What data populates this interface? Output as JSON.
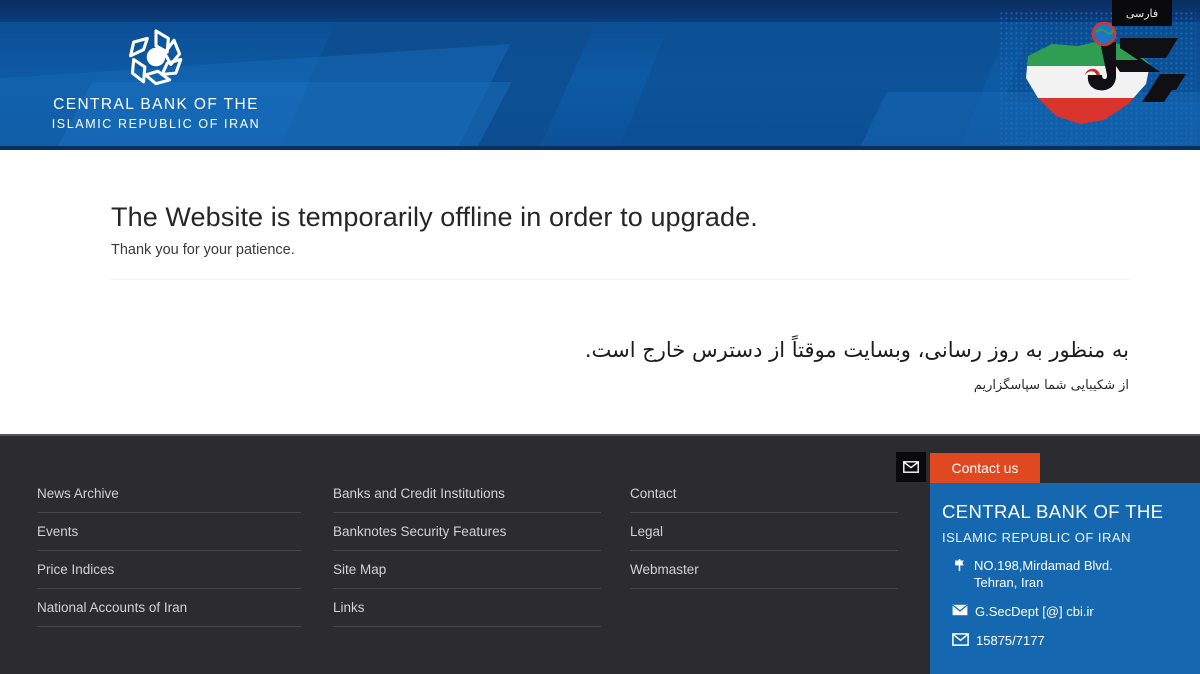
{
  "topbar": {
    "farsi_tab_label": "فارسی"
  },
  "header": {
    "emblem_icon": "cbi-rosette-emblem",
    "brand_line1": "CENTRAL BANK OF THE",
    "brand_line2": "ISLAMIC REPUBLIC OF IRAN",
    "watermark_icon": "iran-map-logo",
    "colors": {
      "navy": "#0b3368",
      "blue": "#0d5ba5"
    }
  },
  "main": {
    "headline": "The Website is temporarily offline in order to upgrade.",
    "subline": "Thank you for your patience.",
    "rtl_message": "به منظور به روز رسانی، وبسایت موقتاً از دسترس خارج است.",
    "rtl_thanks": "از شکیبایی شما سپاسگزاریم"
  },
  "footer": {
    "columns": [
      {
        "links": [
          "News Archive",
          "Events",
          "Price Indices",
          "National Accounts of Iran"
        ]
      },
      {
        "links": [
          "Banks and Credit Institutions",
          "Banknotes Security Features",
          "Site Map",
          "Links"
        ]
      },
      {
        "links": [
          "Contact",
          "Legal",
          "Webmaster"
        ]
      }
    ],
    "contact": {
      "mail_icon": "envelope-icon",
      "tab_label": "Contact us",
      "tab_color": "#e0491f",
      "panel_color": "#1568b0",
      "title1": "CENTRAL BANK OF THE",
      "title2": "ISLAMIC REPUBLIC OF IRAN",
      "address_icon": "location-pin-icon",
      "address_line1": "NO.198,Mirdamad Blvd.",
      "address_line2": "Tehran, Iran",
      "email_icon": "envelope-icon",
      "email": "G.SecDept [@] cbi.ir",
      "postal_icon": "envelope-outline-icon",
      "postal_code": "15875/7177"
    }
  }
}
